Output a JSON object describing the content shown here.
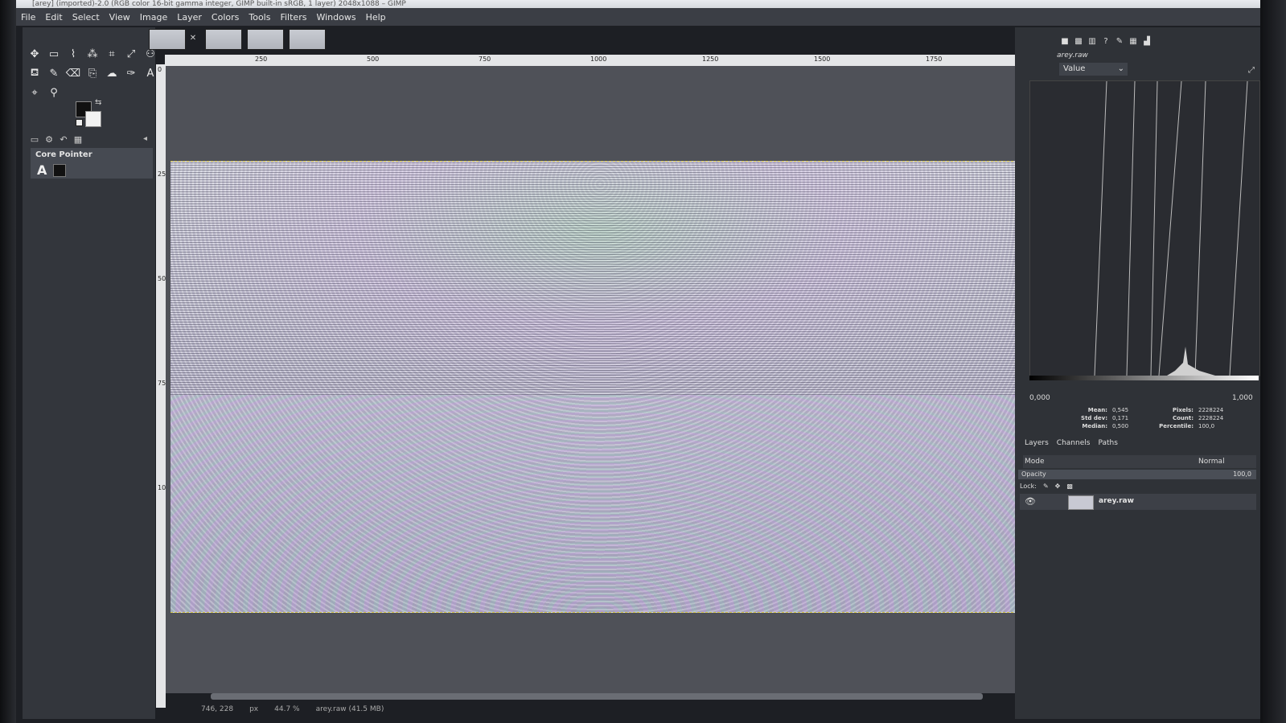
{
  "window": {
    "title": "[arey] (imported)-2.0 (RGB color 16-bit gamma integer, GIMP built-in sRGB, 1 layer) 2048x1088 – GIMP"
  },
  "menu": [
    "File",
    "Edit",
    "Select",
    "View",
    "Image",
    "Layer",
    "Colors",
    "Tools",
    "Filters",
    "Windows",
    "Help"
  ],
  "toolbox": {
    "tools": [
      {
        "name": "move-tool",
        "glyph": "✥"
      },
      {
        "name": "rect-select-tool",
        "glyph": "▭"
      },
      {
        "name": "free-select-tool",
        "glyph": "⌇"
      },
      {
        "name": "fuzzy-select-tool",
        "glyph": "⁂"
      },
      {
        "name": "crop-tool",
        "glyph": "⌗"
      },
      {
        "name": "transform-tool",
        "glyph": "⤢"
      },
      {
        "name": "warp-tool",
        "glyph": "⚇"
      },
      {
        "name": "bucket-fill-tool",
        "glyph": "⛾"
      },
      {
        "name": "paintbrush-tool",
        "glyph": "✎"
      },
      {
        "name": "eraser-tool",
        "glyph": "⌫"
      },
      {
        "name": "clone-tool",
        "glyph": "⎘"
      },
      {
        "name": "smudge-tool",
        "glyph": "☁"
      },
      {
        "name": "paths-tool",
        "glyph": "✑"
      },
      {
        "name": "text-tool",
        "glyph": "A"
      },
      {
        "name": "color-picker-tool",
        "glyph": "⌖"
      },
      {
        "name": "zoom-tool",
        "glyph": "⚲"
      }
    ],
    "tool_options_title": "Core Pointer",
    "tool_options_icon": "A"
  },
  "rulers": {
    "horizontal": [
      "250",
      "500",
      "750",
      "1000",
      "1250",
      "1500",
      "1750"
    ],
    "vertical": [
      "0",
      "250",
      "500",
      "750",
      "1000"
    ]
  },
  "statusbar": {
    "coords": "746, 228",
    "unit": "px",
    "zoom": "44.7 %",
    "info": "arey.raw (41.5 MB)"
  },
  "histogram": {
    "layer_name": "arey.raw",
    "channel": "Value",
    "range_low": "0,000",
    "range_high": "1,000",
    "stats": [
      {
        "label": "Mean:",
        "value": "0,545",
        "label2": "Pixels:",
        "value2": "2228224"
      },
      {
        "label": "Std dev:",
        "value": "0,171",
        "label2": "Count:",
        "value2": "2228224"
      },
      {
        "label": "Median:",
        "value": "0,500",
        "label2": "Percentile:",
        "value2": "100,0"
      }
    ]
  },
  "layers": {
    "tabs": [
      "Layers",
      "Channels",
      "Paths"
    ],
    "mode_label": "Mode",
    "mode_value": "Normal",
    "opacity_label": "Opacity",
    "opacity_value": "100,0",
    "lock_label": "Lock:",
    "items": [
      {
        "name": "arey.raw",
        "visible": true
      }
    ]
  }
}
